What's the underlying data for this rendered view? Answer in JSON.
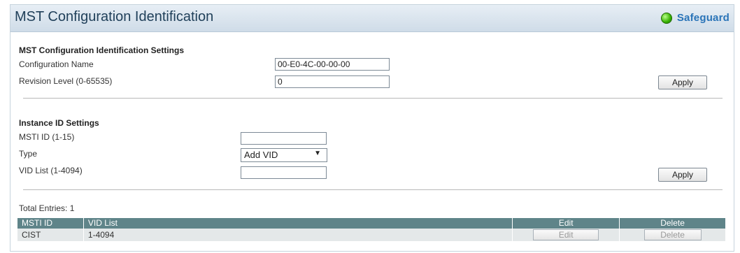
{
  "header": {
    "title": "MST Configuration Identification",
    "safeguard_label": "Safeguard"
  },
  "mst_settings": {
    "section_title": "MST Configuration Identification Settings",
    "config_name_label": "Configuration Name",
    "config_name_value": "00-E0-4C-00-00-00",
    "revision_label": "Revision Level (0-65535)",
    "revision_value": "0",
    "apply_label": "Apply"
  },
  "instance_settings": {
    "section_title": "Instance ID Settings",
    "msti_id_label": "MSTI ID (1-15)",
    "msti_id_value": "",
    "type_label": "Type",
    "type_selected": "Add VID",
    "vid_list_label": "VID List (1-4094)",
    "vid_list_value": "",
    "apply_label": "Apply"
  },
  "table": {
    "total_entries": "Total Entries: 1",
    "headers": [
      "MSTI ID",
      "VID List",
      "Edit",
      "Delete"
    ],
    "rows": [
      {
        "msti_id": "CIST",
        "vid_list": "1-4094",
        "edit_label": "Edit",
        "delete_label": "Delete"
      }
    ]
  },
  "colors": {
    "table_header_bg": "#5f8489",
    "table_row_bg": "#e4e8e9",
    "safeguard_text": "#2a74b8",
    "safeguard_indicator": "#36b000"
  }
}
